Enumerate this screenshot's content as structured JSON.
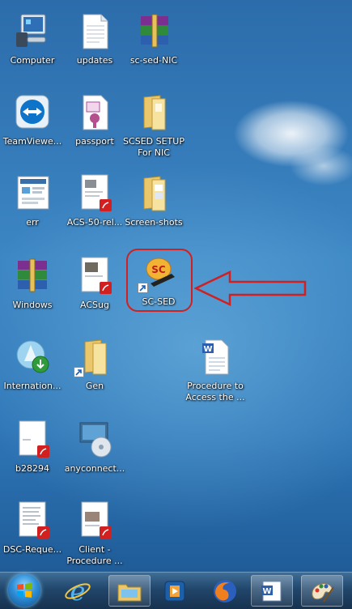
{
  "desktop": {
    "icons": [
      {
        "label": "Computer",
        "icon": "computer-icon"
      },
      {
        "label": "updates",
        "icon": "text-file-icon"
      },
      {
        "label": "sc-sed-NIC",
        "icon": "winrar-archive-icon"
      },
      {
        "label": "TeamViewe...",
        "icon": "teamviewer-icon"
      },
      {
        "label": "passport",
        "icon": "certificate-file-icon"
      },
      {
        "label": "SCSED SETUP For NIC",
        "icon": "folder-icon"
      },
      {
        "label": "err",
        "icon": "screenshot-image-icon"
      },
      {
        "label": "ACS-50-rel...",
        "icon": "pdf-document-icon"
      },
      {
        "label": "Screen-shots",
        "icon": "folder-icon"
      },
      {
        "label": "Windows",
        "icon": "winrar-archive-icon"
      },
      {
        "label": "ACSug",
        "icon": "pdf-document-icon"
      },
      {
        "label": "SC-SED",
        "icon": "sc-sed-app-icon"
      },
      {
        "label": "Internation...",
        "icon": "installer-icon"
      },
      {
        "label": "Gen",
        "icon": "folder-shortcut-icon"
      },
      {
        "label": "Procedure to Access the ...",
        "icon": "word-document-icon"
      },
      {
        "label": "b28294",
        "icon": "pdf-document-icon"
      },
      {
        "label": "anyconnect...",
        "icon": "anyconnect-installer-icon"
      },
      {
        "label": "DSC-Reque...",
        "icon": "pdf-document-icon"
      },
      {
        "label": "Client - Procedure ...",
        "icon": "pdf-document-icon"
      }
    ],
    "highlight_color": "#d21f1f"
  },
  "taskbar": {
    "items": [
      {
        "name": "start-orb-icon"
      },
      {
        "name": "internet-explorer-icon"
      },
      {
        "name": "windows-explorer-icon"
      },
      {
        "name": "media-player-icon"
      },
      {
        "name": "firefox-icon"
      },
      {
        "name": "word-icon"
      },
      {
        "name": "paint-icon"
      }
    ]
  }
}
